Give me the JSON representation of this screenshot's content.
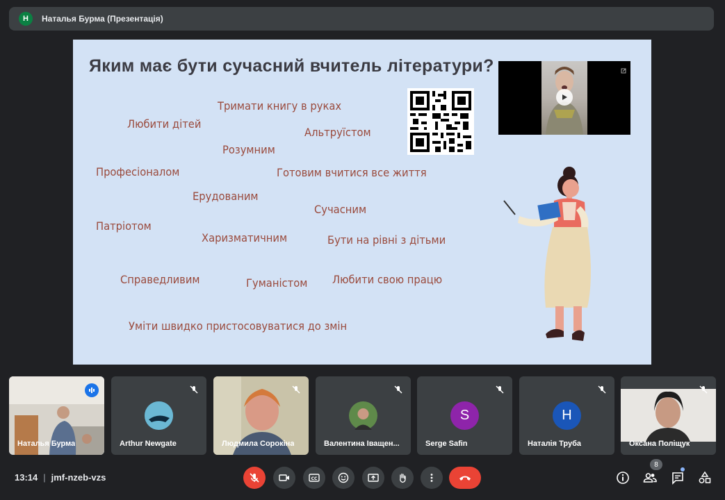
{
  "header": {
    "avatar_letter": "Н",
    "title": "Наталья Бурма (Презентація)"
  },
  "slide": {
    "heading": "Яким має бути сучасний вчитель літератури?",
    "words": [
      "Тримати книгу в руках",
      "Любити дітей",
      "Альтруїстом",
      "Розумним",
      "Професіоналом",
      "Готовим вчитися все життя",
      "Ерудованим",
      "Сучасним",
      "Патріотом",
      "Харизматичним",
      "Бути на рівні з дітьми",
      "Справедливим",
      "Гуманістом",
      "Любити свою працю",
      "Уміти швидко пристосовуватися до змін"
    ]
  },
  "participants": [
    {
      "name": "Наталья Бурма",
      "status": "speaking"
    },
    {
      "name": "Arthur Newgate",
      "status": "muted"
    },
    {
      "name": "Людмила Сорокіна",
      "status": "muted"
    },
    {
      "name": "Валентина Іващен...",
      "status": "muted"
    },
    {
      "name": "Serge Safin",
      "status": "muted",
      "avatar_letter": "S",
      "avatar_color": "#8e24aa"
    },
    {
      "name": "Наталія Труба",
      "status": "muted",
      "avatar_letter": "Н",
      "avatar_color": "#1a56b8"
    },
    {
      "name": "Оксана Поліщук",
      "status": "muted"
    }
  ],
  "meeting": {
    "time": "13:14",
    "separator": "|",
    "code": "jmf-nzeb-vzs",
    "participant_count": "8"
  },
  "colors": {
    "background": "#202124",
    "slide_bg": "#d3e2f5",
    "word_color": "#9a4a3c",
    "danger": "#ea4335",
    "active_outline": "#8ab4f8"
  }
}
